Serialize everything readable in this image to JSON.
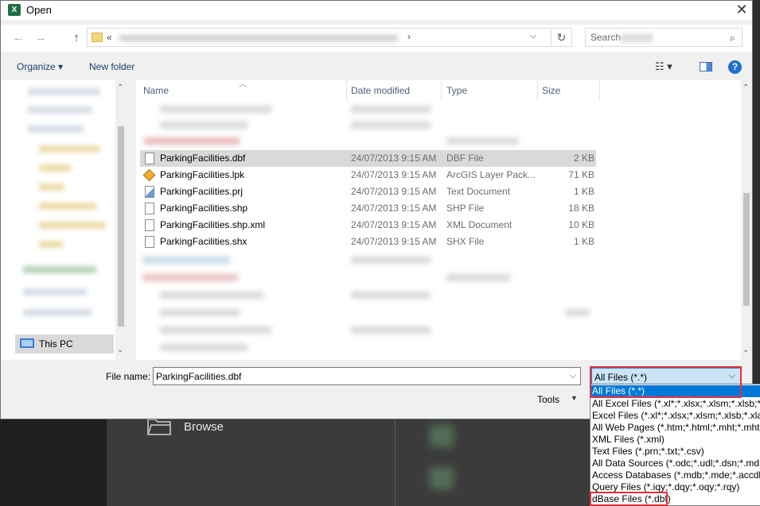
{
  "dialog": {
    "title": "Open",
    "app_icon": "X"
  },
  "nav": {
    "back": "←",
    "forward": "→",
    "up": "↑",
    "address_prefix": "«",
    "address_arrow": "›",
    "dropdown": "⌵",
    "refresh": "↻",
    "search_placeholder": "Search",
    "search_icon": "⌕"
  },
  "commands": {
    "organize": "Organize ▾",
    "new_folder": "New folder",
    "view": "☷ ▾",
    "help": "?"
  },
  "navigation_pane": {
    "this_pc": "This PC"
  },
  "columns": {
    "name": "Name",
    "date": "Date modified",
    "type": "Type",
    "size": "Size"
  },
  "files": [
    {
      "name": "ParkingFacilities.dbf",
      "date": "24/07/2013 9:15 AM",
      "type": "DBF File",
      "size": "2 KB",
      "icon": "file-icon",
      "selected": true
    },
    {
      "name": "ParkingFacilities.lpk",
      "date": "24/07/2013 9:15 AM",
      "type": "ArcGIS Layer Pack...",
      "size": "71 KB",
      "icon": "layer-package-icon"
    },
    {
      "name": "ParkingFacilities.prj",
      "date": "24/07/2013 9:15 AM",
      "type": "Text Document",
      "size": "1 KB",
      "icon": "projection-file-icon"
    },
    {
      "name": "ParkingFacilities.shp",
      "date": "24/07/2013 9:15 AM",
      "type": "SHP File",
      "size": "18 KB",
      "icon": "file-icon"
    },
    {
      "name": "ParkingFacilities.shp.xml",
      "date": "24/07/2013 9:15 AM",
      "type": "XML Document",
      "size": "10 KB",
      "icon": "file-icon"
    },
    {
      "name": "ParkingFacilities.shx",
      "date": "24/07/2013 9:15 AM",
      "type": "SHX File",
      "size": "1 KB",
      "icon": "file-icon"
    }
  ],
  "bottom": {
    "file_name_label": "File name:",
    "file_name_value": "ParkingFacilities.dbf",
    "file_type_value": "All Files (*.*)",
    "tools": "Tools",
    "dropdown_arrow": "⌵"
  },
  "file_types": [
    "All Files (*.*)",
    "All Excel Files (*.xl*;*.xlsx;*.xlsm;*.xlsb;*.xlam;",
    "Excel Files (*.xl*;*.xlsx;*.xlsm;*.xlsb;*.xlam;",
    "All Web Pages (*.htm;*.html;*.mht;*.mhtml)",
    "XML Files (*.xml)",
    "Text Files (*.prn;*.txt;*.csv)",
    "All Data Sources (*.odc;*.udl;*.dsn;*.mdb;",
    "Access Databases (*.mdb;*.mde;*.accdb;",
    "Query Files (*.iqy;*.dqy;*.oqy;*.rqy)",
    "dBase Files (*.dbf)"
  ],
  "backstage": {
    "browse": "Browse"
  },
  "colors": {
    "highlight": "#e0313c",
    "selection": "#0078d7"
  }
}
